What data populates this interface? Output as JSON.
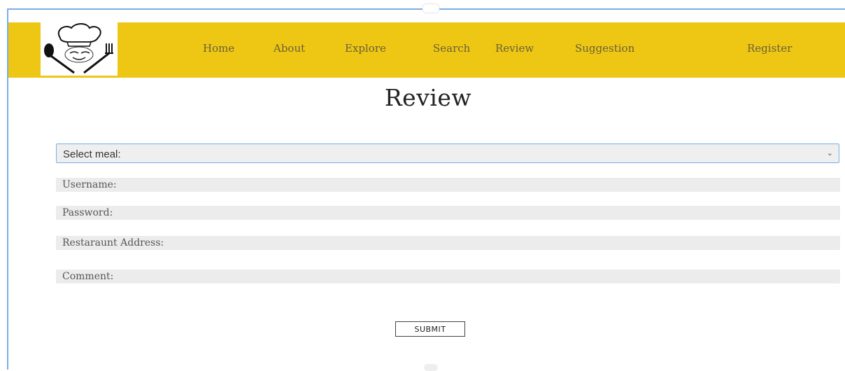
{
  "nav": {
    "logo_icon": "chef-hat-fork-spoon-logo",
    "items": [
      {
        "label": "Home"
      },
      {
        "label": "About"
      },
      {
        "label": "Explore"
      },
      {
        "label": "Search"
      },
      {
        "label": "Review"
      },
      {
        "label": "Suggestion"
      },
      {
        "label": "Register"
      }
    ],
    "background": "#eec715"
  },
  "page": {
    "title": "Review"
  },
  "form": {
    "meal_select": {
      "selected": "Select meal:"
    },
    "fields": [
      {
        "label": "Username:"
      },
      {
        "label": "Password:"
      },
      {
        "label": "Restaraunt Address:"
      },
      {
        "label": "Comment:"
      }
    ],
    "submit_label": "SUBMIT"
  }
}
